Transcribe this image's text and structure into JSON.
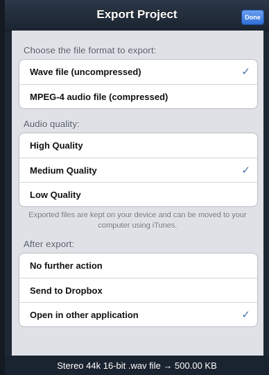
{
  "navbar": {
    "title": "Export Project",
    "done_label": "Done"
  },
  "format_section": {
    "header": "Choose the file format to export:",
    "items": [
      {
        "label": "Wave file (uncompressed)",
        "checked": true
      },
      {
        "label": "MPEG-4 audio file (compressed)",
        "checked": false
      }
    ]
  },
  "quality_section": {
    "header": "Audio quality:",
    "items": [
      {
        "label": "High Quality",
        "checked": false
      },
      {
        "label": "Medium Quality",
        "checked": true
      },
      {
        "label": "Low Quality",
        "checked": false
      }
    ],
    "footer": "Exported files are kept on your device and can be moved to your computer using iTunes."
  },
  "after_section": {
    "header": "After export:",
    "items": [
      {
        "label": "No further action",
        "checked": false
      },
      {
        "label": "Send to Dropbox",
        "checked": false
      },
      {
        "label": "Open in other application",
        "checked": true
      }
    ]
  },
  "check_glyph": "✓",
  "status_bar": {
    "text": "Stereo 44k 16-bit .wav file → 500.00 KB"
  },
  "colors": {
    "accent": "#2f6fd8",
    "checkmark": "#4b6ea6",
    "background": "#dfe1e6"
  }
}
